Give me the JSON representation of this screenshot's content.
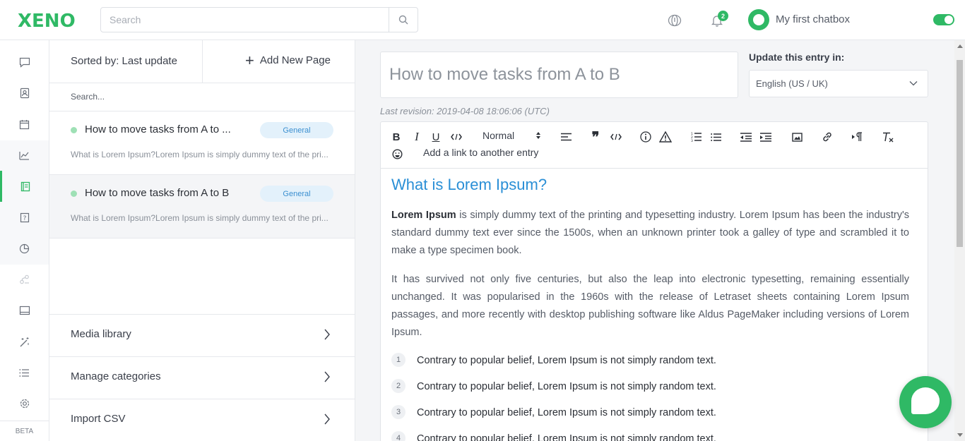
{
  "header": {
    "logo": "XENO",
    "search_placeholder": "Search",
    "notifications_count": "2",
    "chatbox_name": "My first chatbox",
    "chatbox_enabled": true
  },
  "rail": {
    "items": [
      "chat-icon",
      "contacts-icon",
      "calendar-icon",
      "analytics-icon",
      "knowledge-base-icon",
      "help-icon",
      "pie-chart-icon",
      "routing-icon",
      "inbox-icon",
      "magic-wand-icon",
      "list-icon",
      "settings-icon"
    ],
    "active": "knowledge-base-icon",
    "beta_label": "BETA"
  },
  "pages": {
    "sorted_label": "Sorted by: Last update",
    "add_page_label": "Add New Page",
    "search_placeholder": "Search...",
    "items": [
      {
        "title": "How to move tasks from A to ...",
        "tag": "General",
        "excerpt": "What is Lorem Ipsum?Lorem Ipsum is simply dummy text of the pri..."
      },
      {
        "title": "How to move tasks from A to B",
        "tag": "General",
        "excerpt": "What is Lorem Ipsum?Lorem Ipsum is simply dummy text of the pri..."
      }
    ],
    "links": [
      "Media library",
      "Manage categories",
      "Import CSV"
    ]
  },
  "editor": {
    "title_value": "How to move tasks from A to B",
    "update_label": "Update this entry in:",
    "language": "English (US / UK)",
    "revision": "Last revision: 2019-04-08 18:06:06 (UTC)",
    "toolbar": {
      "bold": "B",
      "italic": "I",
      "underline": "U",
      "format": "Normal",
      "add_link": "Add a link to another entry"
    },
    "content": {
      "heading": "What is Lorem Ipsum?",
      "p1_bold": "Lorem Ipsum",
      "p1_rest": " is simply dummy text of the printing and typesetting industry. Lorem Ipsum has been the industry's standard dummy text ever since the 1500s, when an unknown printer took a galley of type and scrambled it to make a type specimen book.",
      "p2": "It has survived not only five centuries, but also the leap into electronic typesetting, remaining essentially unchanged. It was popularised in the 1960s with the release of Letraset sheets containing Lorem Ipsum passages, and more recently with desktop publishing software like Aldus PageMaker including versions of Lorem Ipsum.",
      "list": [
        {
          "num": "1",
          "text": "Contrary to popular belief, Lorem Ipsum is not simply random text."
        },
        {
          "num": "2",
          "text": "Contrary to popular belief, Lorem Ipsum is not simply random text."
        },
        {
          "num": "3",
          "text": "Contrary to popular belief, Lorem Ipsum is not simply random text."
        },
        {
          "num": "4",
          "text": "Contrary to popular belief, Lorem Ipsum is not simply random text."
        }
      ]
    }
  },
  "colors": {
    "brand": "#2fb965",
    "heading": "#2a8fd6",
    "tag_bg": "#e3f1fb"
  }
}
